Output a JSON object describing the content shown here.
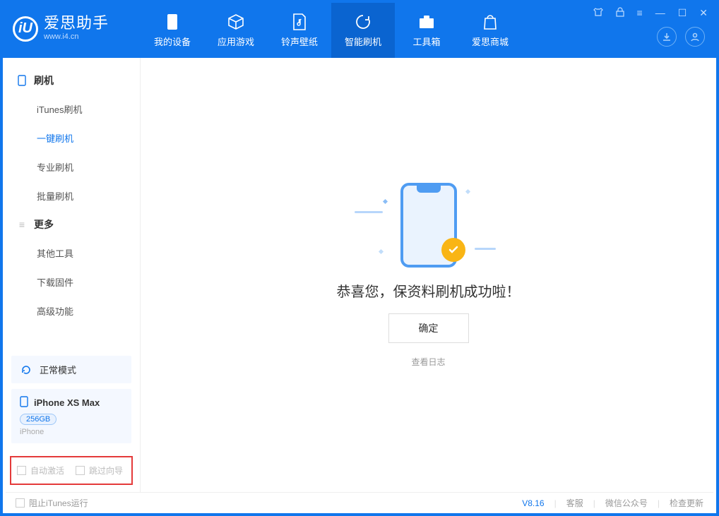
{
  "app": {
    "name": "爱思助手",
    "url": "www.i4.cn"
  },
  "nav": {
    "items": [
      {
        "label": "我的设备"
      },
      {
        "label": "应用游戏"
      },
      {
        "label": "铃声壁纸"
      },
      {
        "label": "智能刷机"
      },
      {
        "label": "工具箱"
      },
      {
        "label": "爱思商城"
      }
    ],
    "active_index": 3
  },
  "sidebar": {
    "groups": [
      {
        "title": "刷机",
        "icon": "phone-icon",
        "items": [
          {
            "label": "iTunes刷机"
          },
          {
            "label": "一键刷机"
          },
          {
            "label": "专业刷机"
          },
          {
            "label": "批量刷机"
          }
        ],
        "active_index": 1
      },
      {
        "title": "更多",
        "icon": "menu-icon",
        "items": [
          {
            "label": "其他工具"
          },
          {
            "label": "下载固件"
          },
          {
            "label": "高级功能"
          }
        ],
        "active_index": -1
      }
    ],
    "mode_label": "正常模式",
    "device": {
      "name": "iPhone XS Max",
      "storage": "256GB",
      "type": "iPhone"
    },
    "options": {
      "auto_activate": "自动激活",
      "skip_guide": "跳过向导"
    }
  },
  "main": {
    "success_text": "恭喜您，保资料刷机成功啦！",
    "ok_button": "确定",
    "view_log": "查看日志"
  },
  "status": {
    "block_itunes": "阻止iTunes运行",
    "version": "V8.16",
    "links": [
      "客服",
      "微信公众号",
      "检查更新"
    ]
  }
}
